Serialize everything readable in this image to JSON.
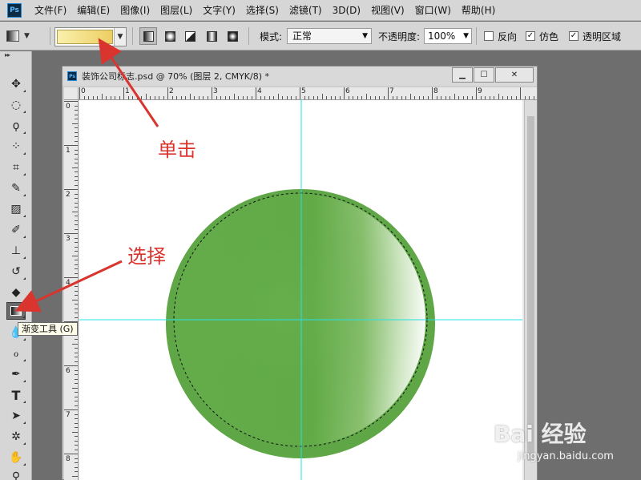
{
  "menubar": {
    "app_icon": "Ps",
    "items": [
      "文件(F)",
      "编辑(E)",
      "图像(I)",
      "图层(L)",
      "文字(Y)",
      "选择(S)",
      "滤镜(T)",
      "3D(D)",
      "视图(V)",
      "窗口(W)",
      "帮助(H)"
    ]
  },
  "options": {
    "mode_label": "模式:",
    "mode_value": "正常",
    "opacity_label": "不透明度:",
    "opacity_value": "100%",
    "reverse_label": "反向",
    "reverse_checked": false,
    "dither_label": "仿色",
    "dither_checked": true,
    "transparency_label": "透明区域",
    "transparency_checked": true,
    "gradient_colors": [
      "#f9f0ad",
      "#edce62"
    ]
  },
  "toolbar": {
    "tools": [
      "move-icon",
      "ellipse-marquee-icon",
      "lasso-icon",
      "quick-selection-icon",
      "crop-icon",
      "eyedropper-icon",
      "healing-brush-icon",
      "brush-icon",
      "clone-stamp-icon",
      "history-brush-icon",
      "eraser-icon",
      "gradient-icon",
      "blur-icon",
      "dodge-icon",
      "pen-icon",
      "type-icon",
      "path-selection-icon",
      "shape-icon",
      "hand-icon",
      "zoom-icon"
    ],
    "active_tool": "gradient-icon",
    "tooltip": "渐变工具 (G)"
  },
  "document": {
    "title": "装饰公司标志.psd @ 70% (图层 2, CMYK/8) *",
    "ruler_h": [
      "0",
      "1",
      "2",
      "3",
      "4",
      "5",
      "6",
      "7",
      "8",
      "9"
    ],
    "ruler_v": [
      "0",
      "1",
      "2",
      "3",
      "4",
      "5",
      "6",
      "7",
      "8"
    ],
    "artwork_colors": {
      "main": "#64ad4a",
      "dark": "#4f9a3a",
      "highlight": "#ffffff",
      "guide": "#27e0e6"
    }
  },
  "annotations": {
    "click": "单击",
    "select": "选择",
    "color": "#d9342e"
  },
  "watermark": {
    "brand": "Bai 经验",
    "url": "jingyan.baidu.com"
  }
}
